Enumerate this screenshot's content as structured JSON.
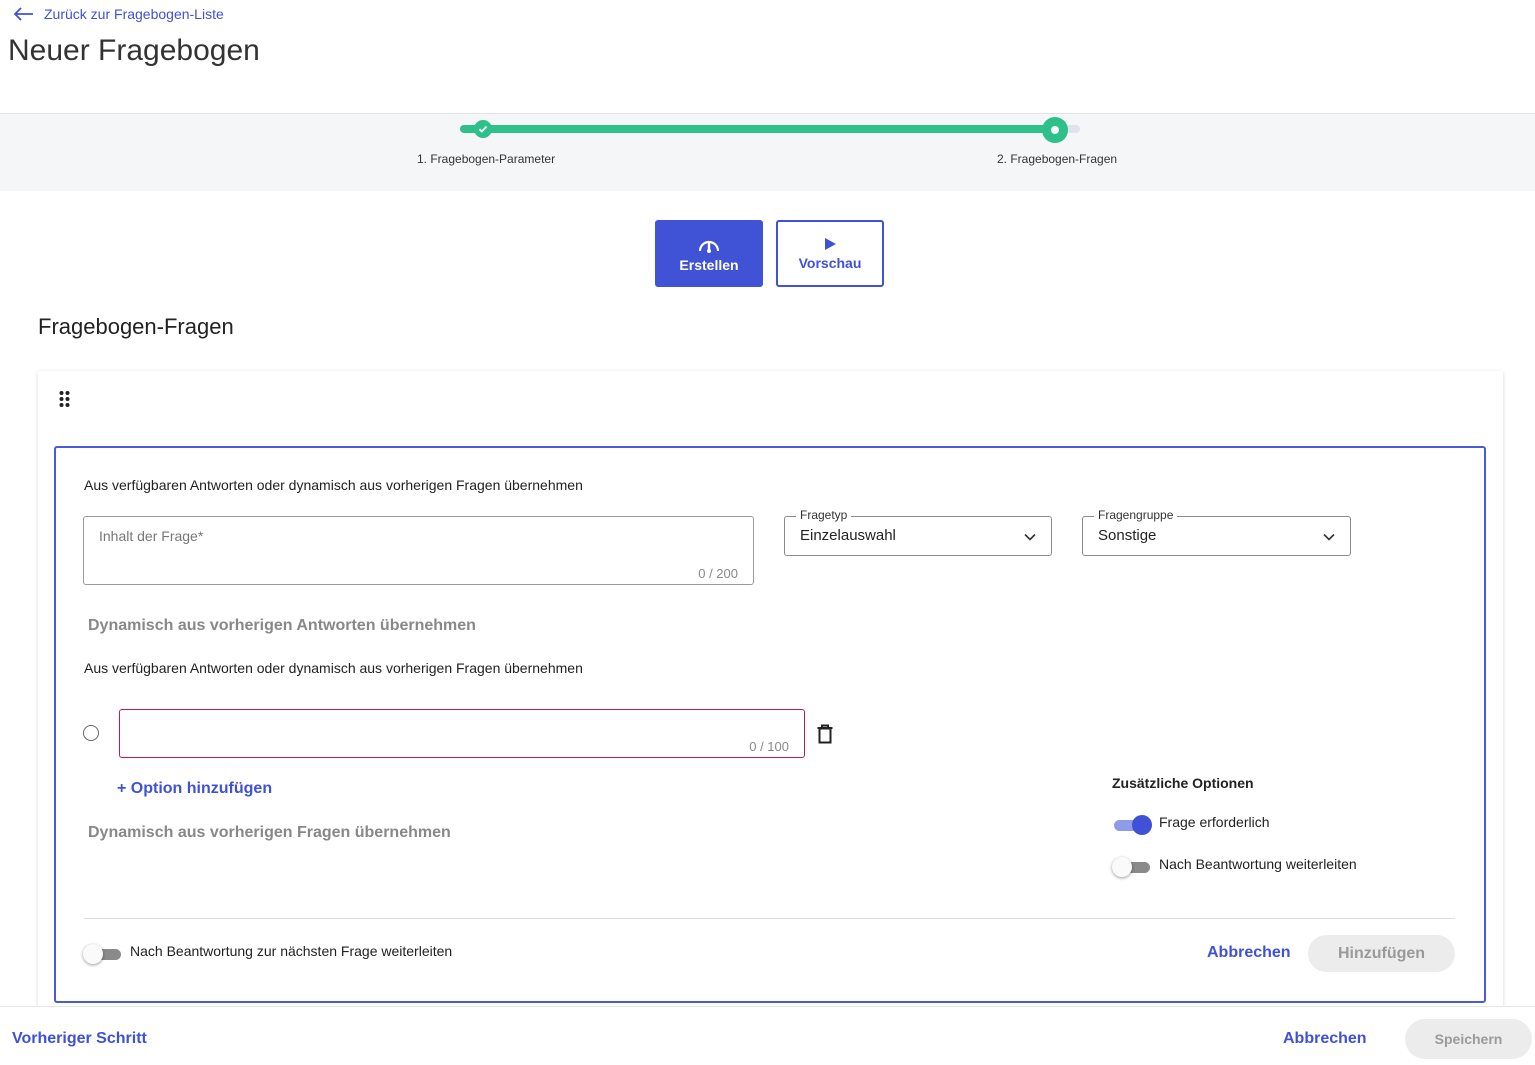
{
  "header": {
    "back_link": "Zurück zur Fragebogen-Liste",
    "title": "Neuer Fragebogen"
  },
  "stepper": {
    "steps": [
      {
        "label": "1. Fragebogen-Parameter",
        "status": "completed"
      },
      {
        "label": "2. Fragebogen-Fragen",
        "status": "active"
      }
    ],
    "progress_color": "#2ec08a"
  },
  "mode": {
    "create_label": "Erstellen",
    "create_icon": "gauge-icon",
    "preview_label": "Vorschau",
    "preview_icon": "play-icon"
  },
  "section": {
    "title": "Fragebogen-Fragen"
  },
  "editor": {
    "helper_top": "Aus verfügbaren Antworten oder dynamisch aus vorherigen Fragen übernehmen",
    "question_placeholder": "Inhalt der Frage*",
    "question_count": "0 / 200",
    "fragetyp": {
      "label": "Fragetyp",
      "value": "Einzelauswahl"
    },
    "fragengruppe": {
      "label": "Fragengruppe",
      "value": "Sonstige"
    },
    "dynamic_answers_link": "Dynamisch aus vorherigen Antworten übernehmen",
    "helper_options": "Aus verfügbaren Antworten oder dynamisch aus vorherigen Fragen übernehmen",
    "option_count": "0 / 100",
    "add_option": "+ Option hinzufügen",
    "dynamic_questions_link": "Dynamisch aus vorherigen Fragen übernehmen",
    "extra_options": {
      "title": "Zusätzliche Optionen",
      "required_label": "Frage erforderlich",
      "required_on": true,
      "redirect_label": "Nach Beantwortung weiterleiten",
      "redirect_on": false
    },
    "next_question_label": "Nach Beantwortung zur nächsten Frage weiterleiten",
    "next_question_on": false,
    "cancel_label": "Abbrechen",
    "add_label": "Hinzufügen"
  },
  "footer": {
    "prev_label": "Vorheriger Schritt",
    "cancel_label": "Abbrechen",
    "save_label": "Speichern"
  },
  "colors": {
    "primary": "#4052d6",
    "success": "#2ec08a",
    "error_border": "#c2185b",
    "disabled_bg": "#ececec"
  }
}
